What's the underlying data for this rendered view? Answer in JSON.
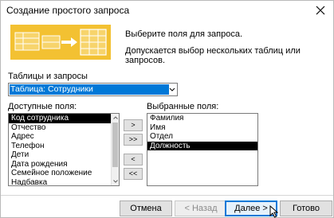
{
  "window": {
    "title": "Создание простого запроса"
  },
  "intro": {
    "line1": "Выберите поля для запроса.",
    "line2": "Допускается выбор нескольких таблиц или запросов."
  },
  "tables": {
    "label": "Таблицы и запросы",
    "selected": "Таблица: Сотрудники"
  },
  "available": {
    "label": "Доступные поля:",
    "items": [
      "Код сотрудника",
      "Отчество",
      "Адрес",
      "Телефон",
      "Дети",
      "Дата рождения",
      "Семейное положение",
      "Надбавка"
    ],
    "selected_index": 0
  },
  "selected_fields": {
    "label": "Выбранные поля:",
    "items": [
      "Фамилия",
      "Имя",
      "Отдел",
      "Должность"
    ],
    "selected_index": 3
  },
  "move_buttons": {
    "add_one": ">",
    "add_all": ">>",
    "remove_one": "<",
    "remove_all": "<<"
  },
  "footer": {
    "cancel": "Отмена",
    "back": "< Назад",
    "next": "Далее >",
    "finish": "Готово"
  },
  "colors": {
    "accent": "#0078d7",
    "wizard_art": "#f3c132"
  },
  "icons": {
    "close": "close-icon",
    "dropdown": "chevron-down-icon",
    "cursor": "mouse-pointer-icon"
  }
}
